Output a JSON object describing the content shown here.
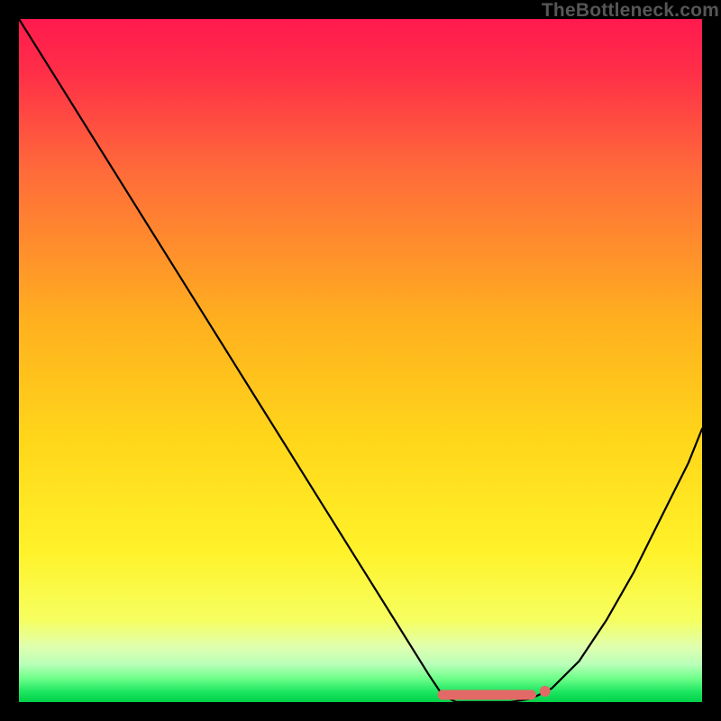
{
  "watermark": "TheBottleneck.com",
  "colors": {
    "top_gradient": "#ff1a4e",
    "mid1_gradient": "#ff6a3a",
    "mid2_gradient": "#ffd71a",
    "low_gradient": "#f6ff60",
    "band_light": "#dfffb0",
    "bottom_gradient": "#00e052",
    "curve": "#000000",
    "highlight": "#e26a66",
    "frame": "#000000"
  },
  "chart_data": {
    "type": "line",
    "title": "",
    "xlabel": "",
    "ylabel": "",
    "xlim": [
      0,
      100
    ],
    "ylim": [
      0,
      100
    ],
    "series": [
      {
        "name": "bottleneck-curve",
        "x": [
          0,
          5,
          10,
          15,
          20,
          25,
          30,
          35,
          40,
          45,
          50,
          55,
          60,
          62,
          64,
          68,
          72,
          75,
          78,
          82,
          86,
          90,
          94,
          98,
          100
        ],
        "values": [
          100,
          92,
          84,
          76,
          68,
          60,
          52,
          44,
          36,
          28,
          20,
          12,
          4,
          1,
          0,
          0,
          0,
          0.5,
          2,
          6,
          12,
          19,
          27,
          35,
          40
        ]
      }
    ],
    "annotations": [
      {
        "name": "optimal-zone-low",
        "segment_x": [
          62,
          75
        ],
        "segment_y": [
          0,
          0
        ]
      },
      {
        "name": "optimal-zone-endpoint",
        "point_x": 77,
        "point_y": 1
      }
    ]
  }
}
